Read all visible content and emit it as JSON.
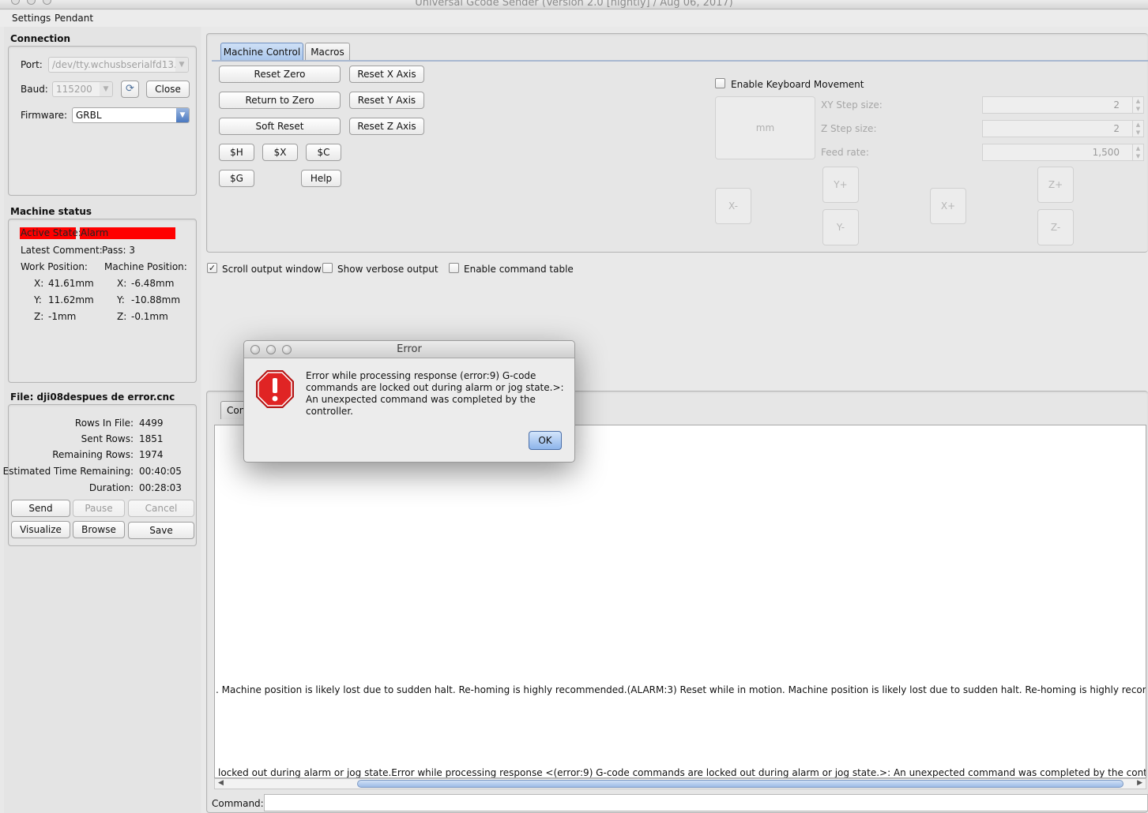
{
  "window": {
    "title": "Universal Gcode Sender (Version 2.0 [nightly]  / Aug 06, 2017)"
  },
  "menu": {
    "items": [
      "Settings",
      "Pendant"
    ]
  },
  "connection": {
    "heading": "Connection",
    "port_label": "Port:",
    "port_value": "/dev/tty.wchusbserialfd13...",
    "baud_label": "Baud:",
    "baud_value": "115200",
    "close_label": "Close",
    "firmware_label": "Firmware:",
    "firmware_value": "GRBL"
  },
  "machine_status": {
    "heading": "Machine status",
    "active_state_label": "Active State:",
    "active_state_value": "Alarm",
    "latest_comment_label": "Latest Comment:",
    "latest_comment_value": "Pass: 3",
    "work_position_label": "Work Position:",
    "machine_position_label": "Machine Position:",
    "work": {
      "x_label": "X:",
      "x": "41.61mm",
      "y_label": "Y:",
      "y": "11.62mm",
      "z_label": "Z:",
      "z": "-1mm"
    },
    "machine": {
      "x_label": "X:",
      "x": "-6.48mm",
      "y_label": "Y:",
      "y": "-10.88mm",
      "z_label": "Z:",
      "z": "-0.1mm"
    },
    "alarm_color": "#ff0000"
  },
  "file": {
    "heading": "File: dji08despues de error.cnc",
    "rows_in_file_label": "Rows In File:",
    "rows_in_file": "4499",
    "sent_rows_label": "Sent Rows:",
    "sent_rows": "1851",
    "remaining_rows_label": "Remaining Rows:",
    "remaining_rows": "1974",
    "est_time_label": "Estimated Time Remaining:",
    "est_time": "00:40:05",
    "duration_label": "Duration:",
    "duration": "00:28:03",
    "buttons": {
      "send": "Send",
      "pause": "Pause",
      "cancel": "Cancel",
      "visualize": "Visualize",
      "browse": "Browse",
      "save": "Save"
    }
  },
  "tabs": {
    "machine_control": "Machine Control",
    "macros": "Macros",
    "console_partial": "Con"
  },
  "machine_control": {
    "reset_zero": "Reset Zero",
    "return_to_zero": "Return to Zero",
    "soft_reset": "Soft Reset",
    "reset_x": "Reset X Axis",
    "reset_y": "Reset Y Axis",
    "reset_z": "Reset Z Axis",
    "home": "$H",
    "unlock": "$X",
    "check": "$C",
    "gcode_state": "$G",
    "help": "Help"
  },
  "jog": {
    "enable_keyboard_label": "Enable Keyboard Movement",
    "units": "mm",
    "xy_step_label": "XY Step size:",
    "xy_step_value": "2",
    "z_step_label": "Z Step size:",
    "z_step_value": "2",
    "feed_rate_label": "Feed rate:",
    "feed_rate_value": "1,500",
    "x_minus": "X-",
    "x_plus": "X+",
    "y_plus": "Y+",
    "y_minus": "Y-",
    "z_plus": "Z+",
    "z_minus": "Z-"
  },
  "options": {
    "scroll_output": "Scroll output window",
    "scroll_output_checked": true,
    "verbose_output": "Show verbose output",
    "verbose_output_checked": false,
    "command_table": "Enable command table",
    "command_table_checked": false
  },
  "console": {
    "line1": ". Machine position is likely lost due to sudden halt. Re-homing is highly recommended.(ALARM:3) Reset while in motion. Machine position is likely lost due to sudden halt. Re-homing is highly recommended",
    "line2": "locked out during alarm or jog state.Error while processing response <(error:9) G-code commands are locked out during alarm or jog state.>: An unexpected command was completed by the controller.",
    "command_label": "Command:",
    "command_value": ""
  },
  "dialog": {
    "title": "Error",
    "message": "Error while processing response (error:9) G-code commands are locked out during alarm or jog state.>: An unexpected command was completed by the controller.",
    "ok_label": "OK",
    "icon": "error-stop-sign-icon",
    "icon_color": "#d11a1a"
  }
}
